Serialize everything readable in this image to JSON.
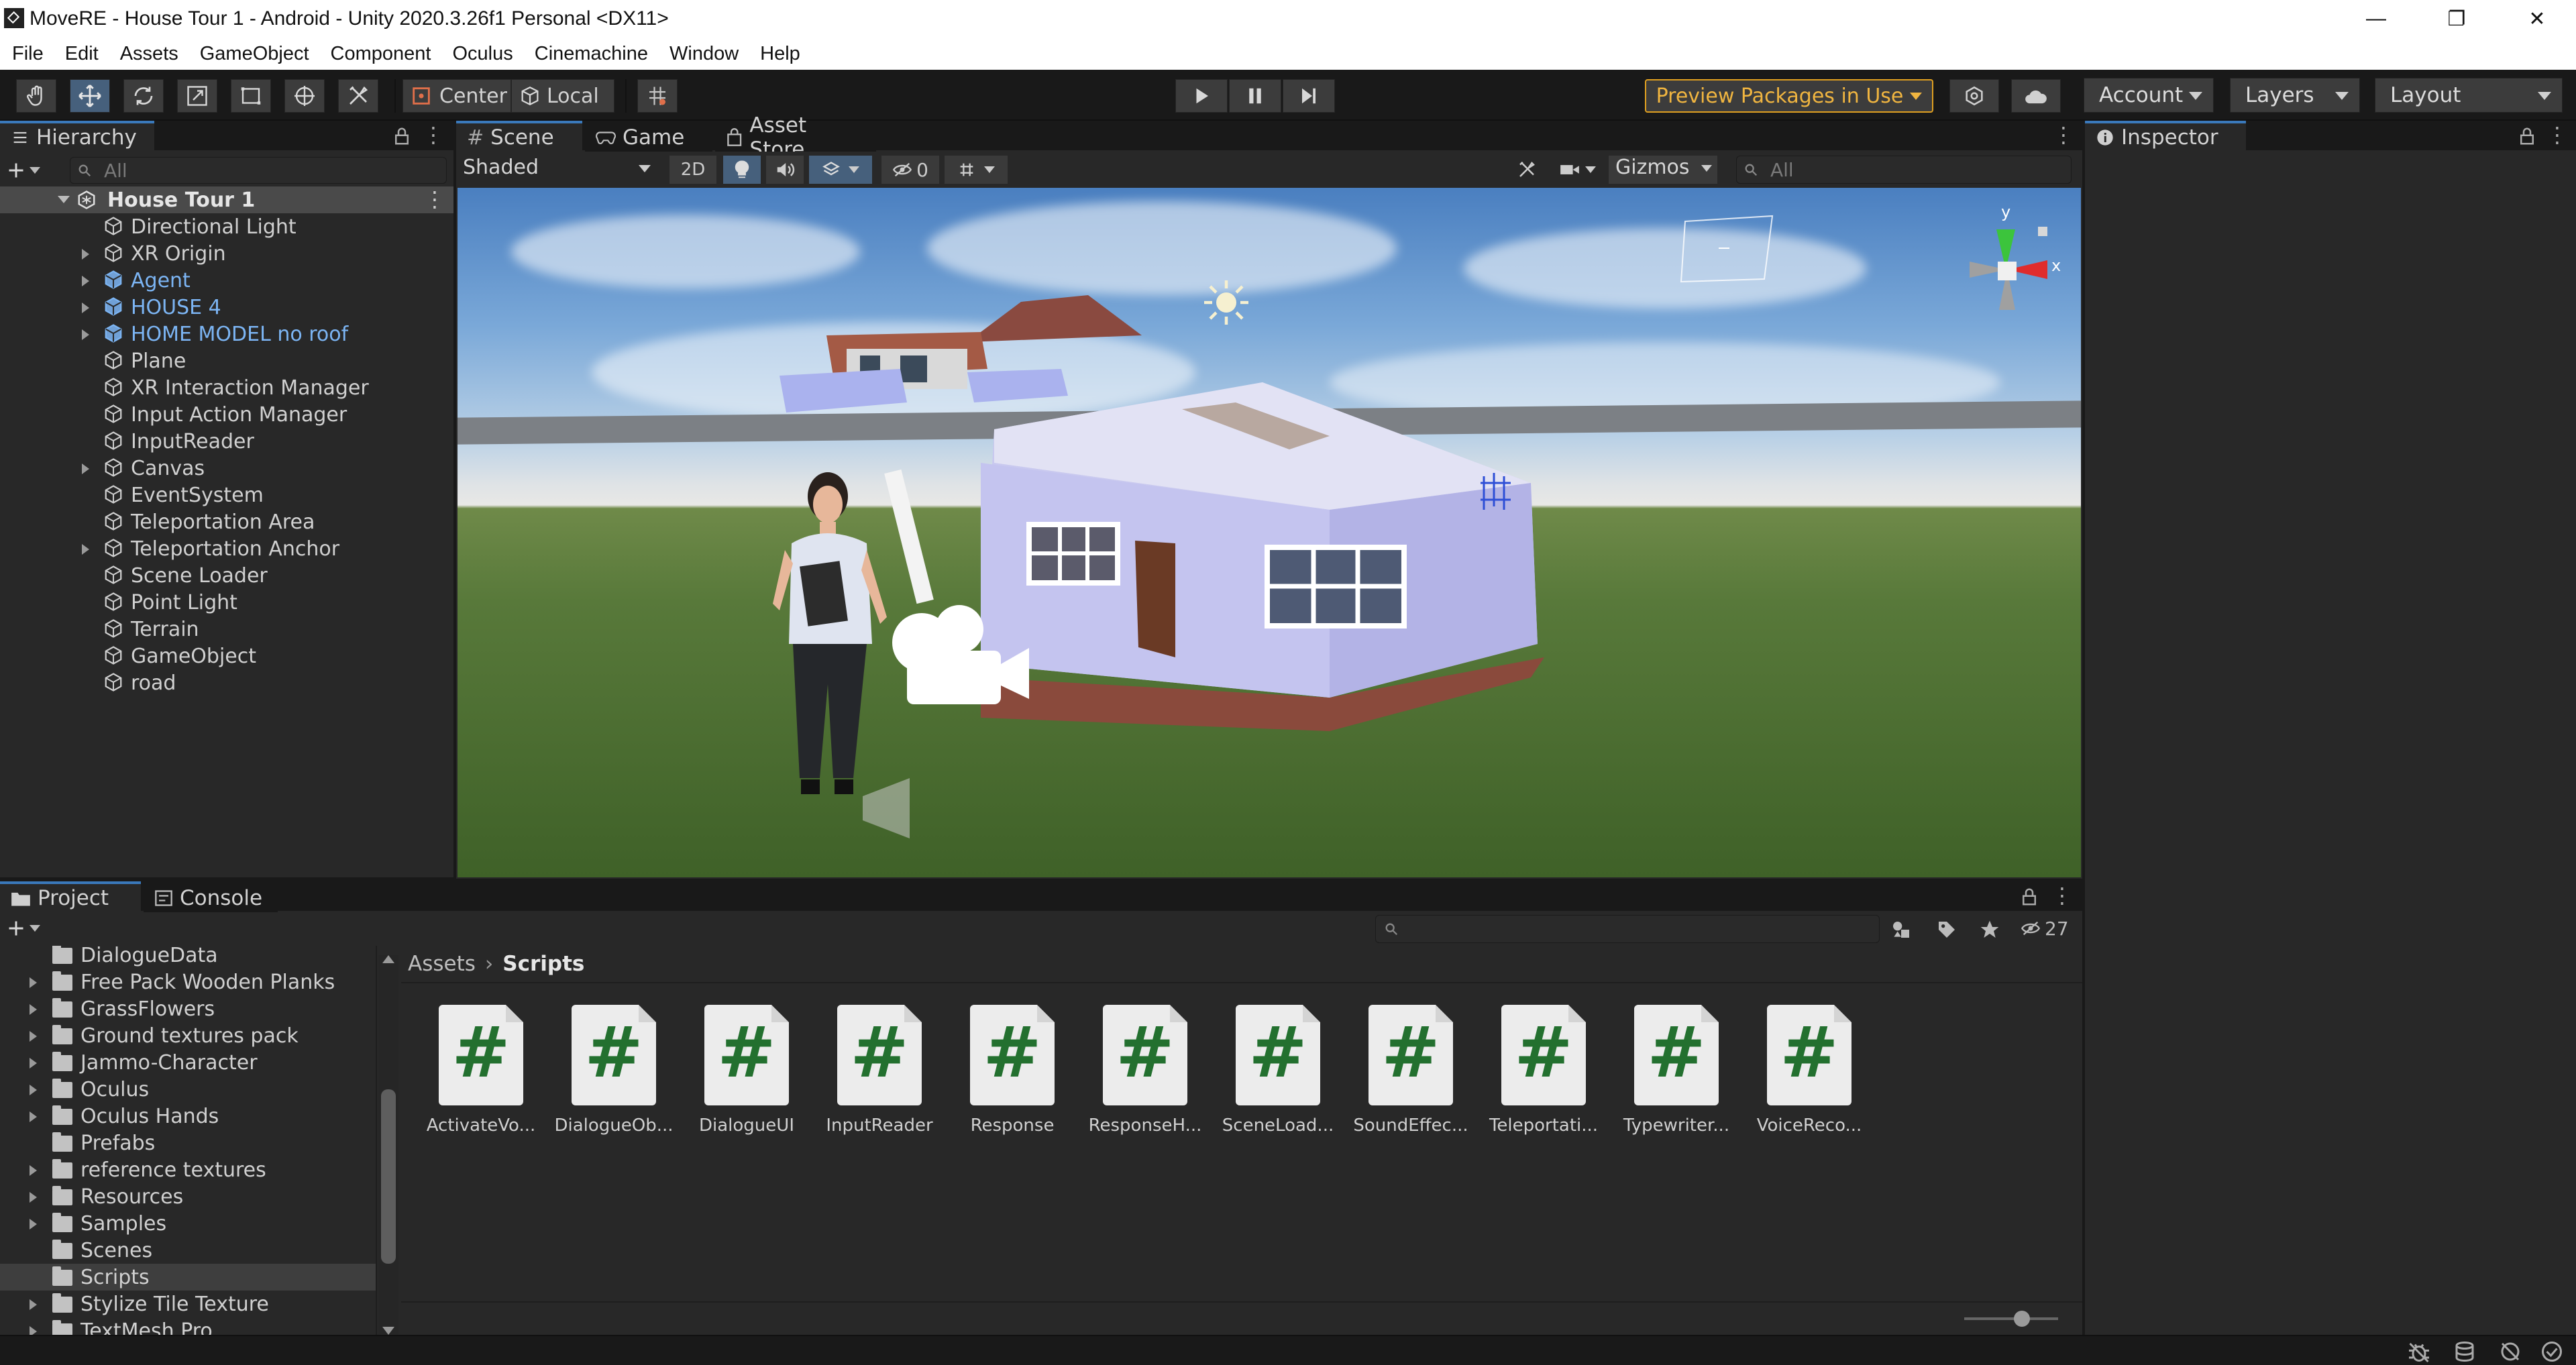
{
  "window": {
    "title": "MoveRE - House Tour 1 - Android - Unity 2020.3.26f1 Personal <DX11>",
    "controls": [
      "—",
      "❐",
      "✕"
    ]
  },
  "menubar": [
    "File",
    "Edit",
    "Assets",
    "GameObject",
    "Component",
    "Oculus",
    "Cinemachine",
    "Window",
    "Help"
  ],
  "toolbar": {
    "tools": [
      "hand-tool",
      "move-tool",
      "rotate-tool",
      "scale-tool",
      "rect-tool",
      "transform-tool",
      "custom-tool"
    ],
    "pivot": "Center",
    "space": "Local",
    "preview_packages": "Preview Packages in Use",
    "account": "Account",
    "layers": "Layers",
    "layout": "Layout"
  },
  "hierarchy": {
    "tab": "Hierarchy",
    "search_placeholder": "All",
    "scene_name": "House Tour 1",
    "items": [
      {
        "label": "Directional Light",
        "expandable": false,
        "prefab": false
      },
      {
        "label": "XR Origin",
        "expandable": true,
        "prefab": false
      },
      {
        "label": "Agent",
        "expandable": true,
        "prefab": true
      },
      {
        "label": "HOUSE 4",
        "expandable": true,
        "prefab": true
      },
      {
        "label": "HOME MODEL no roof",
        "expandable": true,
        "prefab": true
      },
      {
        "label": "Plane",
        "expandable": false,
        "prefab": false
      },
      {
        "label": "XR Interaction Manager",
        "expandable": false,
        "prefab": false
      },
      {
        "label": "Input Action Manager",
        "expandable": false,
        "prefab": false
      },
      {
        "label": "InputReader",
        "expandable": false,
        "prefab": false
      },
      {
        "label": "Canvas",
        "expandable": true,
        "prefab": false
      },
      {
        "label": "EventSystem",
        "expandable": false,
        "prefab": false
      },
      {
        "label": "Teleportation Area",
        "expandable": false,
        "prefab": false
      },
      {
        "label": "Teleportation Anchor",
        "expandable": true,
        "prefab": false
      },
      {
        "label": "Scene Loader",
        "expandable": false,
        "prefab": false
      },
      {
        "label": "Point Light",
        "expandable": false,
        "prefab": false
      },
      {
        "label": "Terrain",
        "expandable": false,
        "prefab": false
      },
      {
        "label": "GameObject",
        "expandable": false,
        "prefab": false
      },
      {
        "label": "road",
        "expandable": false,
        "prefab": false
      }
    ]
  },
  "scene_view": {
    "tabs": [
      "Scene",
      "Game",
      "Asset Store"
    ],
    "shading_mode": "Shaded",
    "mode_2d": "2D",
    "hidden_count": "0",
    "gizmos": "Gizmos",
    "search_placeholder": "All",
    "axis_y": "y",
    "axis_x": "x"
  },
  "inspector": {
    "tab": "Inspector"
  },
  "project": {
    "tabs": [
      "Project",
      "Console"
    ],
    "hidden_count": "27",
    "breadcrumb": [
      "Assets",
      "Scripts"
    ],
    "folders": [
      {
        "label": "DialogueData",
        "expandable": false
      },
      {
        "label": "Free Pack Wooden Planks",
        "expandable": true
      },
      {
        "label": "GrassFlowers",
        "expandable": true
      },
      {
        "label": "Ground textures pack",
        "expandable": true
      },
      {
        "label": "Jammo-Character",
        "expandable": true
      },
      {
        "label": "Oculus",
        "expandable": true
      },
      {
        "label": "Oculus Hands",
        "expandable": true
      },
      {
        "label": "Prefabs",
        "expandable": false
      },
      {
        "label": "reference textures",
        "expandable": true
      },
      {
        "label": "Resources",
        "expandable": true
      },
      {
        "label": "Samples",
        "expandable": true
      },
      {
        "label": "Scenes",
        "expandable": false
      },
      {
        "label": "Scripts",
        "expandable": false,
        "selected": true
      },
      {
        "label": "Stylize Tile Texture",
        "expandable": true
      },
      {
        "label": "TextMesh Pro",
        "expandable": true
      }
    ],
    "assets": [
      "ActivateVo...",
      "DialogueOb...",
      "DialogueUI",
      "InputReader",
      "Response",
      "ResponseH...",
      "SceneLoad...",
      "SoundEffec...",
      "Teleportati...",
      "Typewriter...",
      "VoiceReco..."
    ]
  },
  "colors": {
    "accent": "#3a79bb",
    "prefab_text": "#7cb5f4",
    "script_hash": "#23702f",
    "preview_border": "#e0a020"
  }
}
